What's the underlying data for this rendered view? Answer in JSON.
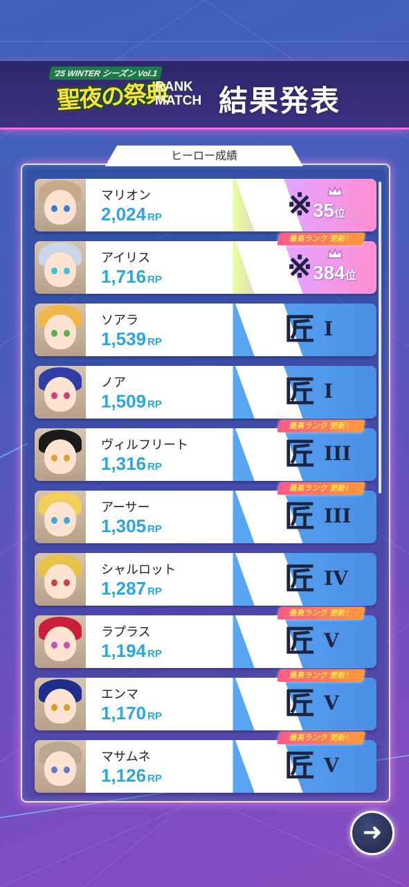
{
  "header": {
    "season_tag": "'25 WINTER シーズン Vol.1",
    "event_title": "聖夜の祭典",
    "rank_match_line1": "RANK",
    "rank_match_line2": "MATCH",
    "result_title": "結果発表"
  },
  "panel": {
    "tab_label": "ヒーロー成績"
  },
  "rows": [
    {
      "name": "マリオン",
      "rp": "2,024",
      "unit": "RP",
      "rank": "legend",
      "place": "35",
      "place_unit": "位",
      "best_update": false,
      "hair": "#c9a98c",
      "eye": "#3a7bd5"
    },
    {
      "name": "アイリス",
      "rp": "1,716",
      "unit": "RP",
      "rank": "legend",
      "place": "384",
      "place_unit": "位",
      "best_update": true,
      "hair": "#c8d6e6",
      "eye": "#3fc3d8"
    },
    {
      "name": "ソアラ",
      "rp": "1,539",
      "unit": "RP",
      "rank": "匠",
      "tier": "I",
      "best_update": false,
      "hair": "#f0b64a",
      "eye": "#58b04a"
    },
    {
      "name": "ノア",
      "rp": "1,509",
      "unit": "RP",
      "rank": "匠",
      "tier": "I",
      "best_update": false,
      "hair": "#2e3da8",
      "eye": "#d23c7a"
    },
    {
      "name": "ヴィルフリート",
      "rp": "1,316",
      "unit": "RP",
      "rank": "匠",
      "tier": "III",
      "best_update": true,
      "hair": "#1a1a1a",
      "eye": "#e0a030"
    },
    {
      "name": "アーサー",
      "rp": "1,305",
      "unit": "RP",
      "rank": "匠",
      "tier": "III",
      "best_update": true,
      "hair": "#f2cf5a",
      "eye": "#3fa8d8"
    },
    {
      "name": "シャルロット",
      "rp": "1,287",
      "unit": "RP",
      "rank": "匠",
      "tier": "IV",
      "best_update": false,
      "hair": "#e6c24a",
      "eye": "#d04040"
    },
    {
      "name": "ラプラス",
      "rp": "1,194",
      "unit": "RP",
      "rank": "匠",
      "tier": "V",
      "best_update": true,
      "hair": "#c8203a",
      "eye": "#c850b0"
    },
    {
      "name": "エンマ",
      "rp": "1,170",
      "unit": "RP",
      "rank": "匠",
      "tier": "V",
      "best_update": true,
      "hair": "#1e2e8a",
      "eye": "#e09a20"
    },
    {
      "name": "マサムネ",
      "rp": "1,126",
      "unit": "RP",
      "rank": "匠",
      "tier": "V",
      "best_update": true,
      "hair": "#b8a890",
      "eye": "#6a78c8"
    }
  ],
  "badge_text": "最高ランク 更新！",
  "next_button_icon": "arrow-right-icon",
  "colors": {
    "accent_pink": "#ff6ad5",
    "rp_blue": "#2aa6e6",
    "tier_dark": "#1c2440"
  }
}
